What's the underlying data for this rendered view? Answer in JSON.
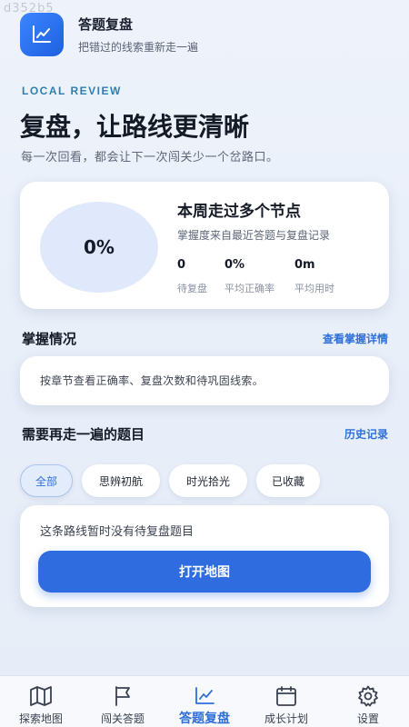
{
  "watermark": "d352b5",
  "header": {
    "title": "答题复盘",
    "subtitle": "把错过的线索重新走一遍",
    "icon": "trend-chart-icon"
  },
  "hero": {
    "kicker": "LOCAL REVIEW",
    "title": "复盘，让路线更清晰",
    "description": "每一次回看，都会让下一次闯关少一个岔路口。"
  },
  "stats": {
    "percent": "0%",
    "title": "本周走过多个节点",
    "description": "掌握度来自最近答题与复盘记录",
    "items": [
      {
        "value": "0",
        "label": "待复盘"
      },
      {
        "value": "0%",
        "label": "平均正确率"
      },
      {
        "value": "0m",
        "label": "平均用时"
      }
    ]
  },
  "mastery": {
    "title": "掌握情况",
    "link": "查看掌握详情",
    "text": "按章节查看正确率、复盘次数和待巩固线索。"
  },
  "review": {
    "title": "需要再走一遍的题目",
    "link": "历史记录",
    "chips": [
      "全部",
      "思辨初航",
      "时光拾光",
      "已收藏"
    ],
    "active_chip": "全部",
    "empty_text": "这条路线暂时没有待复盘题目",
    "button": "打开地图"
  },
  "tabbar": {
    "items": [
      {
        "label": "探索地图",
        "icon": "map-icon"
      },
      {
        "label": "闯关答题",
        "icon": "flag-icon"
      },
      {
        "label": "答题复盘",
        "icon": "trend-chart-icon"
      },
      {
        "label": "成长计划",
        "icon": "calendar-icon"
      },
      {
        "label": "设置",
        "icon": "gear-icon"
      }
    ],
    "active": "答题复盘"
  },
  "colors": {
    "accent": "#2f6ce0",
    "link": "#2e6fd8",
    "kicker": "#2f7fae"
  }
}
